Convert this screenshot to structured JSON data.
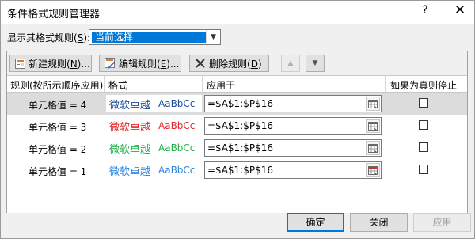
{
  "window": {
    "title": "条件格式规则管理器",
    "help_label": "?",
    "close_label": "✕"
  },
  "show_rules": {
    "label_prefix": "显示其格式规则(",
    "label_hotkey": "S",
    "label_suffix": "):",
    "selected_value": "当前选择"
  },
  "toolbar": {
    "new_rule": {
      "text": "新建规则(",
      "hotkey": "N",
      "suffix": ")..."
    },
    "edit_rule": {
      "text": "编辑规则(",
      "hotkey": "E",
      "suffix": ")..."
    },
    "delete_rule": {
      "text": "删除规则(",
      "hotkey": "D",
      "suffix": ")"
    },
    "move_up_label": "▲",
    "move_down_label": "▼"
  },
  "columns": {
    "rule": "规则(按所示顺序应用)",
    "format": "格式",
    "applies_to": "应用于",
    "stop_if_true": "如果为真则停止"
  },
  "rules": [
    {
      "name": "单元格值 = 4",
      "preview_cn": "微软卓越",
      "preview_en": "AaBbCc",
      "color": "#1f4e9e",
      "applies_to": "=$A$1:$P$16",
      "stop_if_true": false,
      "selected": true
    },
    {
      "name": "单元格值 = 3",
      "preview_cn": "微软卓越",
      "preview_en": "AaBbCc",
      "color": "#e0282a",
      "applies_to": "=$A$1:$P$16",
      "stop_if_true": false,
      "selected": false
    },
    {
      "name": "单元格值 = 2",
      "preview_cn": "微软卓越",
      "preview_en": "AaBbCc",
      "color": "#22b14c",
      "applies_to": "=$A$1:$P$16",
      "stop_if_true": false,
      "selected": false
    },
    {
      "name": "单元格值 = 1",
      "preview_cn": "微软卓越",
      "preview_en": "AaBbCc",
      "color": "#2e86de",
      "applies_to": "=$A$1:$P$16",
      "stop_if_true": false,
      "selected": false
    }
  ],
  "buttons": {
    "ok": "确定",
    "close": "关闭",
    "apply": "应用"
  },
  "colors": {
    "accent": "#0078d7",
    "selected_row": "#dcdcdc"
  }
}
